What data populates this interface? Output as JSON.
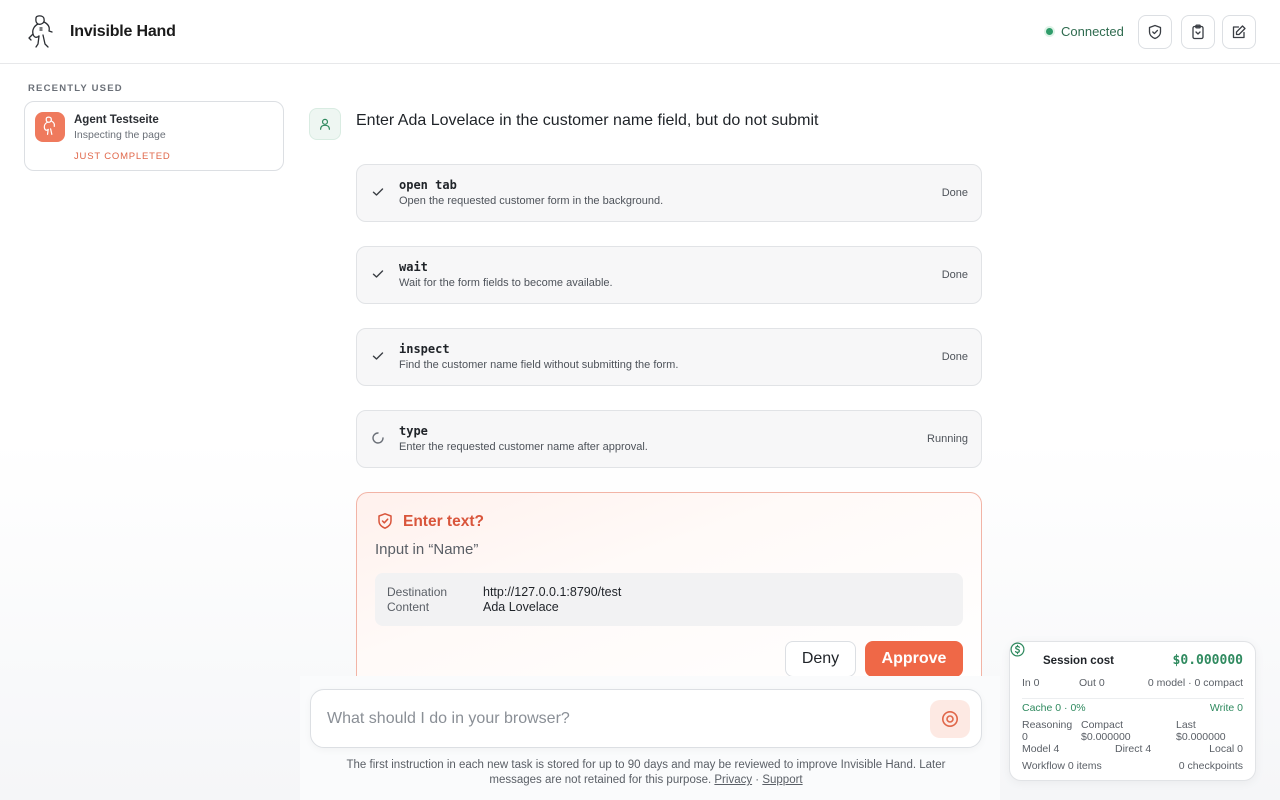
{
  "header": {
    "app_name": "Invisible Hand",
    "status": "Connected"
  },
  "sidebar": {
    "section_label": "RECENTLY USED",
    "recent": {
      "title": "Agent Testseite",
      "subtitle": "Inspecting the page",
      "state": "JUST COMPLETED"
    }
  },
  "chat": {
    "prompt": "Enter Ada Lovelace in the customer name field, but do not submit",
    "steps": [
      {
        "name": "open tab",
        "desc": "Open the requested customer form in the background.",
        "status": "Done"
      },
      {
        "name": "wait",
        "desc": "Wait for the form fields to become available.",
        "status": "Done"
      },
      {
        "name": "inspect",
        "desc": "Find the customer name field without submitting the form.",
        "status": "Done"
      },
      {
        "name": "type",
        "desc": "Enter the requested customer name after approval.",
        "status": "Running"
      }
    ],
    "approval": {
      "title": "Enter text?",
      "subtitle": "Input in “Name”",
      "destination_label": "Destination",
      "destination_value": "http://127.0.0.1:8790/test",
      "content_label": "Content",
      "content_value": "Ada Lovelace",
      "deny_label": "Deny",
      "approve_label": "Approve"
    }
  },
  "composer": {
    "placeholder": "What should I do in your browser?",
    "disclaimer_text": "The first instruction in each new task is stored for up to 90 days and may be reviewed to improve Invisible Hand. Later messages are not retained for this purpose.",
    "privacy_label": "Privacy",
    "separator": "·",
    "support_label": "Support"
  },
  "session_cost": {
    "title": "Session cost",
    "total": "$0.000000",
    "in": "In 0",
    "out": "Out 0",
    "models": "0 model · 0 compact",
    "cache": "Cache 0 · 0%",
    "write": "Write 0",
    "reasoning_label": "Reasoning",
    "reasoning_value": "0",
    "compact_label": "Compact",
    "compact_value": "$0.000000",
    "last_label": "Last",
    "last_value": "$0.000000",
    "model": "Model 4",
    "direct": "Direct 4",
    "local": "Local 0",
    "workflow": "Workflow 0 items",
    "checkpoints": "0 checkpoints"
  },
  "colors": {
    "accent": "#ef6847",
    "success": "#2f8a5f"
  }
}
